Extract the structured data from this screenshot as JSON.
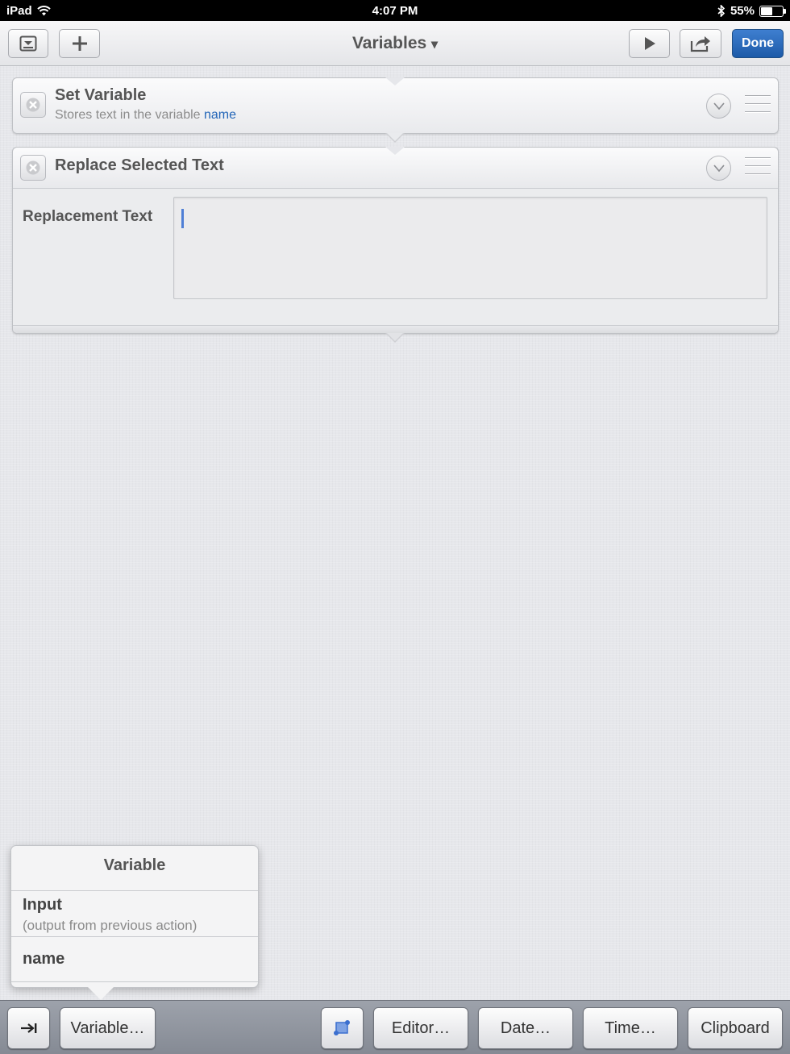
{
  "status_bar": {
    "device": "iPad",
    "time": "4:07 PM",
    "battery_text": "55%",
    "battery_level": 0.55
  },
  "toolbar": {
    "title": "Variables",
    "done_label": "Done",
    "left_icons": [
      "collapse-icon",
      "add-icon"
    ],
    "right_icons": [
      "play-icon",
      "share-icon"
    ]
  },
  "actions": [
    {
      "title": "Set Variable",
      "subtitle_prefix": "Stores text in the variable",
      "variable_name": "name"
    },
    {
      "title": "Replace Selected Text",
      "field_label": "Replacement Text",
      "field_value": ""
    }
  ],
  "popover": {
    "title": "Variable",
    "items": [
      {
        "title": "Input",
        "subtitle": "(output from previous action)"
      },
      {
        "title": "name"
      }
    ]
  },
  "bottom_bar": {
    "tab_icon": "tab-key-icon",
    "variable_label": "Variable…",
    "selection_icon": "selection-icon",
    "editor_label": "Editor…",
    "date_label": "Date…",
    "time_label": "Time…",
    "clipboard_label": "Clipboard"
  },
  "colors": {
    "accent_blue": "#2366b8",
    "done_button": "#1c5aa8",
    "caret": "#4f7fd6"
  }
}
